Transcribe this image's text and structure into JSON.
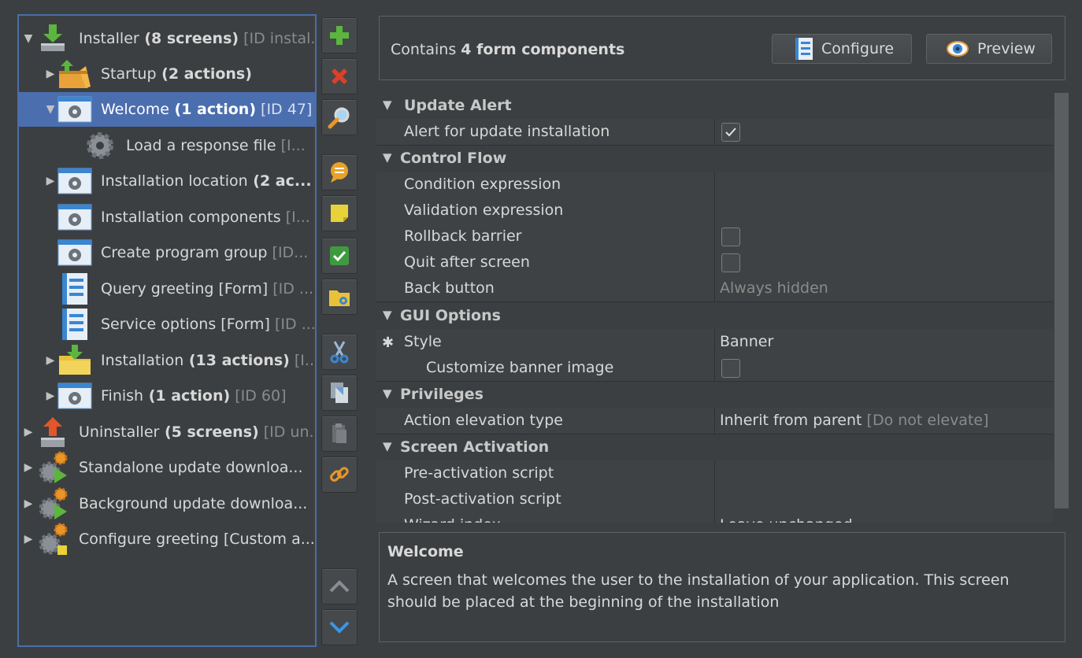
{
  "tree": {
    "nodes": [
      {
        "arrow": "down",
        "icon": "installer-icon",
        "label": "Installer",
        "bold": " (8 screens)",
        "extra": " [ID instal..."
      },
      {
        "arrow": "right",
        "icon": "startup-folder-icon",
        "label": "Startup",
        "bold": " (2 actions)",
        "extra": ""
      },
      {
        "arrow": "down",
        "icon": "screen-gear-icon",
        "label": "Welcome",
        "bold": " (1 action)",
        "extra": " [ID 47]"
      },
      {
        "arrow": "",
        "icon": "gear-icon",
        "label": "Load a response file",
        "bold": "",
        "extra": " [I..."
      },
      {
        "arrow": "right",
        "icon": "screen-gear-icon",
        "label": "Installation location",
        "bold": " (2 ac...",
        "extra": ""
      },
      {
        "arrow": "",
        "icon": "screen-gear-icon",
        "label": "Installation components",
        "bold": "",
        "extra": " [I..."
      },
      {
        "arrow": "",
        "icon": "screen-gear-icon",
        "label": "Create program group",
        "bold": "",
        "extra": " [ID..."
      },
      {
        "arrow": "",
        "icon": "form-icon",
        "label": "Query greeting [Form]",
        "bold": "",
        "extra": " [ID ..."
      },
      {
        "arrow": "",
        "icon": "form-icon",
        "label": "Service options [Form]",
        "bold": "",
        "extra": " [ID ..."
      },
      {
        "arrow": "right",
        "icon": "install-folder-icon",
        "label": "Installation",
        "bold": " (13 actions)",
        "extra": " [I..."
      },
      {
        "arrow": "right",
        "icon": "screen-gear-icon",
        "label": "Finish",
        "bold": " (1 action)",
        "extra": " [ID 60]"
      },
      {
        "arrow": "right",
        "icon": "uninstaller-icon",
        "label": "Uninstaller",
        "bold": " (5 screens)",
        "extra": " [ID un..."
      },
      {
        "arrow": "right",
        "icon": "gears-play-icon",
        "label": "Standalone update downloa...",
        "bold": "",
        "extra": ""
      },
      {
        "arrow": "right",
        "icon": "gears-play-icon",
        "label": "Background update downloa...",
        "bold": "",
        "extra": ""
      },
      {
        "arrow": "right",
        "icon": "gears-note-icon",
        "label": "Configure greeting [Custom a...",
        "bold": "",
        "extra": ""
      }
    ]
  },
  "toolbar": [
    "add-icon",
    "delete-icon",
    "search-icon",
    "comment-icon",
    "note-icon",
    "check-icon",
    "folder-gear-icon",
    "cut-icon",
    "copy-icon",
    "paste-icon",
    "link-icon",
    "move-up-icon",
    "move-down-icon"
  ],
  "header": {
    "contains_prefix": "Contains ",
    "contains_bold": "4 form components",
    "configure_label": "Configure",
    "preview_label": "Preview"
  },
  "properties": {
    "update_alert": "Update Alert",
    "alert_for_update": "Alert for update installation",
    "control_flow": "Control Flow",
    "condition_expression": "Condition expression",
    "validation_expression": "Validation expression",
    "rollback_barrier": "Rollback barrier",
    "quit_after_screen": "Quit after screen",
    "back_button": "Back button",
    "back_button_value": "Always hidden",
    "gui_options": "GUI Options",
    "style_marker": "✱",
    "style": "Style",
    "style_value": "Banner",
    "customize_banner": "Customize banner image",
    "privileges": "Privileges",
    "action_elevation": "Action elevation type",
    "action_elevation_value": "Inherit from parent",
    "action_elevation_hint": "[Do not elevate]",
    "screen_activation": "Screen Activation",
    "pre_activation": "Pre-activation script",
    "post_activation": "Post-activation script",
    "wizard_index": "Wizard index",
    "wizard_index_value": "Leave unchanged"
  },
  "description": {
    "title": "Welcome",
    "body": "A screen that welcomes the user to the installation of your application. This screen should be placed at the beginning of the installation"
  }
}
